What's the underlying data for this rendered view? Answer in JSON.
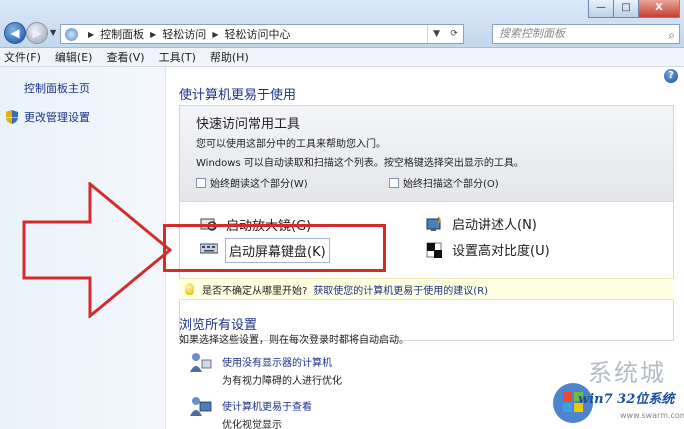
{
  "window": {
    "minimize": "—",
    "maximize": "□",
    "close": "X"
  },
  "address": {
    "crumbs": [
      "控制面板",
      "轻松访问",
      "轻松访问中心"
    ],
    "search_placeholder": "搜索控制面板"
  },
  "menu": [
    "文件(F)",
    "编辑(E)",
    "查看(V)",
    "工具(T)",
    "帮助(H)"
  ],
  "sidebar": {
    "items": [
      "控制面板主页",
      "更改管理设置"
    ]
  },
  "main": {
    "heading": "使计算机更易于使用",
    "quick_panel": {
      "title": "快速访问常用工具",
      "line1": "您可以使用这部分中的工具来帮助您入门。",
      "line2": "Windows 可以自动读取和扫描这个列表。按空格键选择突出显示的工具。",
      "check_read": "始终朗读这个部分(W)",
      "check_scan": "始终扫描这个部分(O)"
    },
    "tools": {
      "magnifier": "启动放大镜(G)",
      "narrator": "启动讲述人(N)",
      "keyboard": "启动屏幕键盘(K)",
      "contrast": "设置高对比度(U)"
    },
    "tip": {
      "text": "是否不确定从哪里开始?",
      "link": "获取使您的计算机更易于使用的建议(R)"
    },
    "browse": {
      "heading": "浏览所有设置",
      "desc": "如果选择这些设置，则在每次登录时都将自动启动。",
      "items": [
        {
          "link": "使用没有显示器的计算机",
          "desc": "为有视力障碍的人进行优化"
        },
        {
          "link": "使计算机更易于查看",
          "desc": "优化视觉显示"
        }
      ]
    }
  },
  "watermark": {
    "zh": "系统城",
    "main": "win7 32位系统",
    "url": "www.swarm.com.cn"
  },
  "colors": {
    "link": "#1e3287",
    "highlight_box": "#d22c2c",
    "tip_bg": "#ffffe1"
  }
}
